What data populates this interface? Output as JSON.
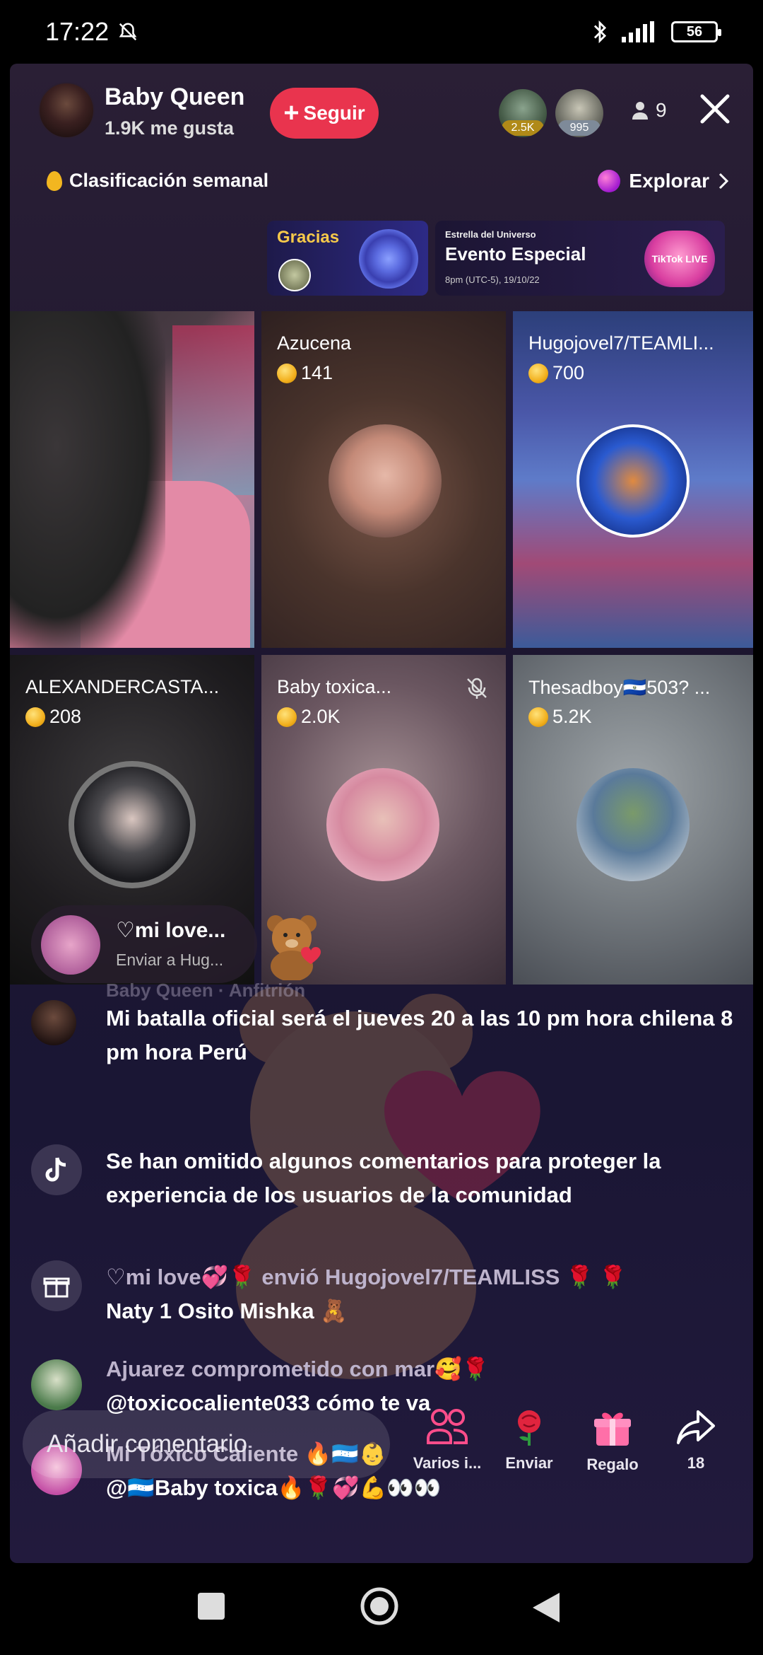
{
  "status": {
    "time": "17:22",
    "battery": "56"
  },
  "host": {
    "name": "Baby Queen",
    "likes": "1.9K me gusta",
    "follow_label": "Seguir"
  },
  "top_gifters": [
    {
      "amount": "2.5K"
    },
    {
      "amount": "995"
    }
  ],
  "viewer_count": "9",
  "ranking_label": "Clasificación semanal",
  "explore_label": "Explorar",
  "banners": {
    "gracias": "Gracias",
    "event_small": "Estrella del Universo",
    "event_title": "Evento Especial",
    "event_date": "8pm (UTC-5), 19/10/22",
    "event_logo": "TikTok LIVE"
  },
  "guests": [
    {
      "name": "Azucena",
      "coins": "141"
    },
    {
      "name": "Hugojovel7/TEAMLI...",
      "coins": "700"
    },
    {
      "name": "ALEXANDERCASTA...",
      "coins": "208"
    },
    {
      "name": "Baby toxica...",
      "coins": "2.0K"
    },
    {
      "name": "Thesadboy🇸🇻503? ...",
      "coins": "5.2K"
    }
  ],
  "gift_popup": {
    "sender": "♡mi love...",
    "target": "Enviar a Hug..."
  },
  "chat": [
    {
      "user": "Baby Queen · Anfitrión",
      "text": "Mi batalla oficial será el jueves 20 a las 10 pm hora chilena 8 pm hora Perú"
    },
    {
      "user": "",
      "text": "Se han omitido algunos comentarios para proteger la experiencia de los usuarios de la comunidad"
    },
    {
      "user": "♡mi love💞🌹 envió Hugojovel7/TEAMLISS 🌹 🌹",
      "text": "Naty 1 Osito Mishka 🧸"
    },
    {
      "user": "Ajuarez comprometido con mar🥰🌹",
      "text": "@toxicocaliente033 cómo te va"
    },
    {
      "user": "Mi Tóxico Caliente 🔥🇭🇳👶",
      "text": "@🇭🇳Baby toxica🔥🌹💞💪👀👀"
    }
  ],
  "bottom": {
    "comment_placeholder": "Añadir comentario",
    "actions": [
      {
        "label": "Varios i..."
      },
      {
        "label": "Enviar"
      },
      {
        "label": "Regalo"
      },
      {
        "label": "18"
      }
    ]
  }
}
